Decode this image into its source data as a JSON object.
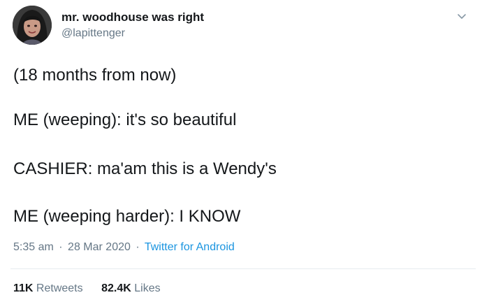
{
  "user": {
    "display_name": "mr. woodhouse was right",
    "handle": "@lapittenger",
    "avatar_icon": "profile-photo"
  },
  "tweet": {
    "lines": [
      "(18 months from now)",
      "ME (weeping): it's so beautiful",
      "CASHIER: ma'am this is a Wendy's",
      "ME (weeping harder): I KNOW"
    ]
  },
  "meta": {
    "time": "5:35 am",
    "date": "28 Mar 2020",
    "separator": "·",
    "source": "Twitter for Android"
  },
  "stats": {
    "retweets_count": "11K",
    "retweets_label": "Retweets",
    "likes_count": "82.4K",
    "likes_label": "Likes"
  },
  "colors": {
    "text": "#14171a",
    "secondary": "#657786",
    "link": "#1b95e0",
    "divider": "#e6ecf0"
  }
}
